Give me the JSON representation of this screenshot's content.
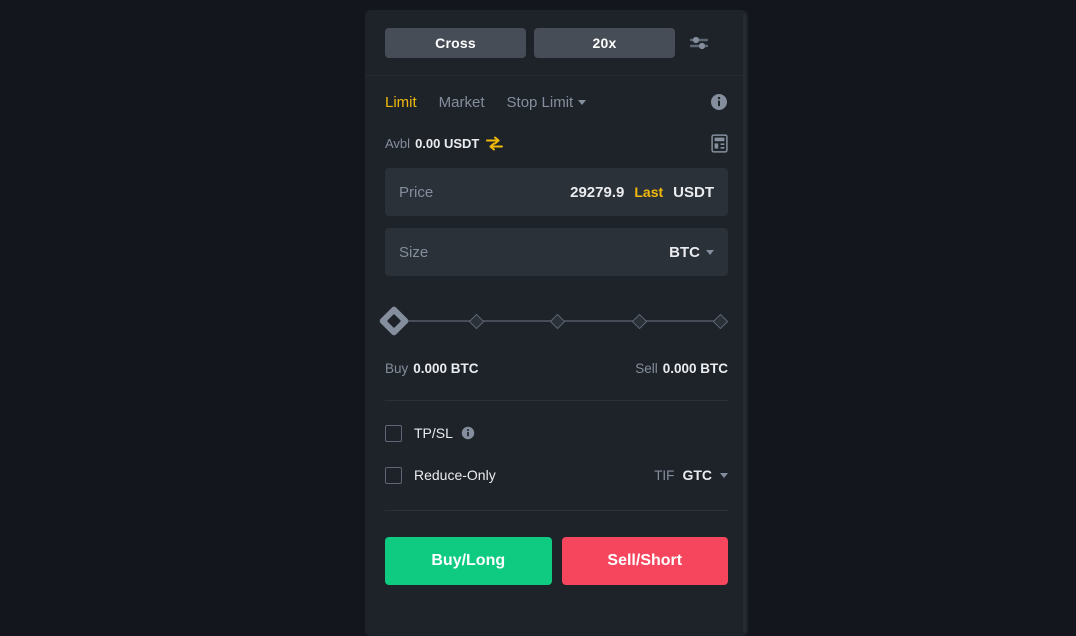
{
  "panel": {
    "margin_mode": {
      "label": "Cross",
      "icon": "margin-mode-button"
    },
    "leverage": {
      "label": "20x"
    },
    "settings_icon": "sliders-settings-icon",
    "tabs": [
      {
        "label": "Limit",
        "active": true
      },
      {
        "label": "Market",
        "active": false
      },
      {
        "label": "Stop Limit",
        "active": false,
        "has_caret": true
      }
    ],
    "info_icon": "info-circle-icon",
    "available": {
      "label": "Avbl",
      "value": "0.00 USDT",
      "transfer_icon": "transfer-arrows-icon",
      "calculator_icon": "calculator-icon"
    },
    "price_field": {
      "label": "Price",
      "value": "29279.9",
      "last_label": "Last",
      "unit": "USDT"
    },
    "size_field": {
      "placeholder": "Size",
      "value": "",
      "unit": "BTC"
    },
    "slider": {
      "value_percent": 0,
      "stops": [
        0,
        25,
        50,
        75,
        100
      ]
    },
    "estimates": {
      "buy_label": "Buy",
      "buy_value": "0.000 BTC",
      "sell_label": "Sell",
      "sell_value": "0.000 BTC"
    },
    "tpsl": {
      "label": "TP/SL",
      "checked": false,
      "info_icon": "info-circle-icon"
    },
    "reduce_only": {
      "label": "Reduce-Only",
      "checked": false
    },
    "tif": {
      "label": "TIF",
      "value": "GTC"
    },
    "buy_button": {
      "label": "Buy/Long",
      "color": "#0ecb81"
    },
    "sell_button": {
      "label": "Sell/Short",
      "color": "#f6465d"
    }
  },
  "colors": {
    "page_background": "#14161d",
    "panel_background": "#1e2329",
    "field_background": "#2b3139",
    "segment_button": "#474d57",
    "accent_yellow": "#f0b90b",
    "text_primary": "#eaecef",
    "text_muted": "#848e9c",
    "buy_green": "#0ecb81",
    "sell_red": "#f6465d"
  }
}
